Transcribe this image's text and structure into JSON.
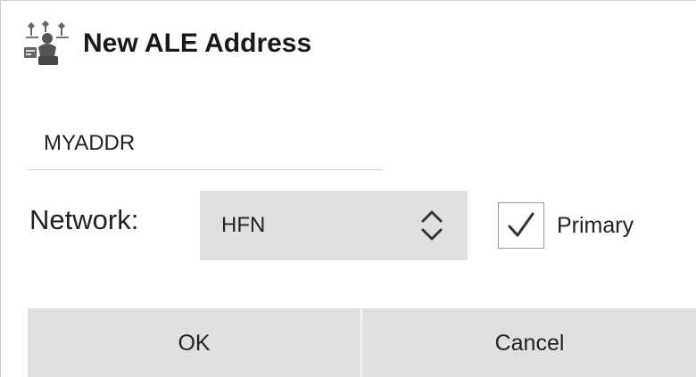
{
  "dialog": {
    "title": "New ALE Address",
    "title_icon": "network-tower-icon"
  },
  "address": {
    "value": "MYADDR"
  },
  "network": {
    "label": "Network:",
    "selected": "HFN",
    "icon": "updown-chevrons-icon"
  },
  "primary": {
    "label": "Primary",
    "checked": true
  },
  "buttons": {
    "ok_label": "OK",
    "cancel_label": "Cancel"
  }
}
